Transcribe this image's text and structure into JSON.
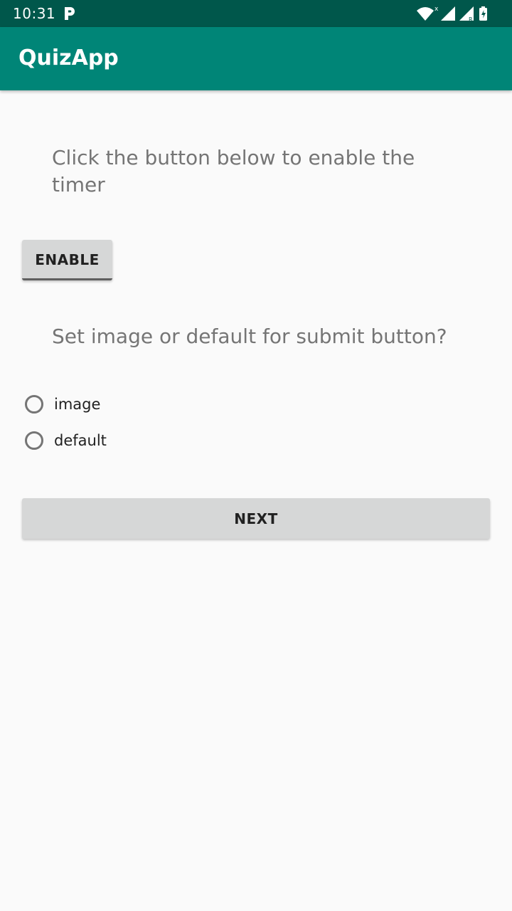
{
  "status_bar": {
    "time": "10:31",
    "notification_icon": "p-icon",
    "icons": [
      "wifi-icon",
      "signal-icon",
      "signal-roaming-icon",
      "battery-charging-icon"
    ],
    "colors": {
      "background": "#00574b"
    }
  },
  "app_bar": {
    "title": "QuizApp",
    "colors": {
      "background": "#008577"
    }
  },
  "main": {
    "timer_prompt": "Click the button below to enable the timer",
    "enable_button_label": "ENABLE",
    "submit_prompt": "Set image or default for submit button?",
    "radio_options": [
      {
        "label": "image",
        "checked": false
      },
      {
        "label": "default",
        "checked": false
      }
    ],
    "next_button_label": "NEXT"
  }
}
